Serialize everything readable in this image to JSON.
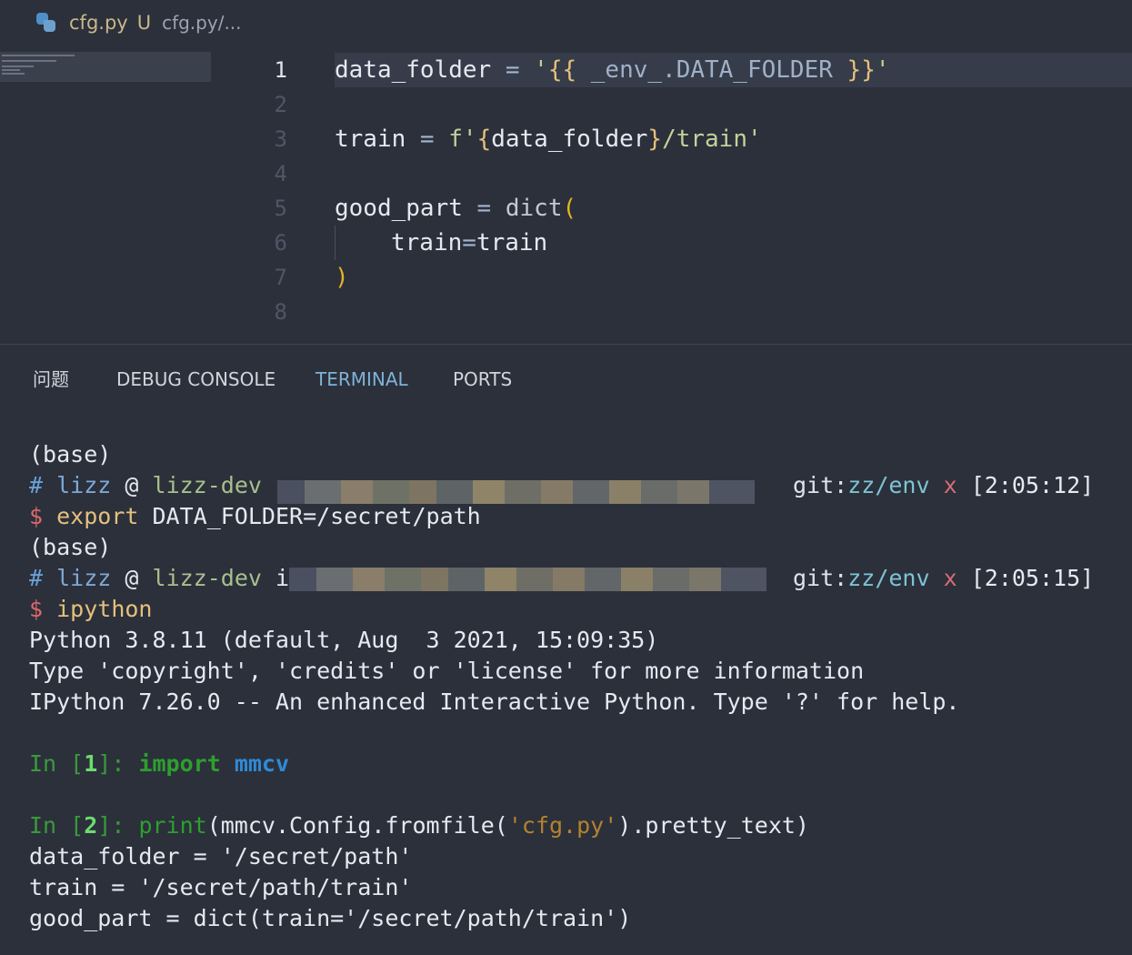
{
  "tab": {
    "filename": "cfg.py",
    "status": "U",
    "path": "cfg.py/..."
  },
  "editor": {
    "line_numbers": [
      "1",
      "2",
      "3",
      "4",
      "5",
      "6",
      "7",
      "8"
    ],
    "l1_var": "data_folder",
    "l1_eq": " = ",
    "l1_q1": "'",
    "l1_open": "{{",
    "l1_mid": " _env_.DATA_FOLDER ",
    "l1_close": "}}",
    "l1_q2": "'",
    "l3_var": "train",
    "l3_eq": " = ",
    "l3_f": "f'",
    "l3_open": "{",
    "l3_inner": "data_folder",
    "l3_close": "}",
    "l3_rest": "/train'",
    "l5_var": "good_part",
    "l5_eq": " = ",
    "l5_fn": "dict",
    "l5_paren": "(",
    "l6_k": "train",
    "l6_eq": "=",
    "l6_v": "train",
    "l7_paren": ")"
  },
  "panel": {
    "tabs": [
      "问题",
      "DEBUG CONSOLE",
      "TERMINAL",
      "PORTS"
    ]
  },
  "terminal": {
    "base": "(base)",
    "hash": "#",
    "user": "lizz",
    "at": "@",
    "host": "lizz-dev",
    "in1": "i",
    "git_label": "git:",
    "branch": "zz/env",
    "x": "x",
    "time1": "[2:05:12]",
    "time2": "[2:05:15]",
    "dollar": "$",
    "cmd1": "export",
    "cmd1_arg": "DATA_FOLDER=/secret/path",
    "cmd2": "ipython",
    "py_ver": "Python 3.8.11 (default, Aug  3 2021, 15:09:35)",
    "type_line": "Type 'copyright', 'credits' or 'license' for more information",
    "ipy_line": "IPython 7.26.0 -- An enhanced Interactive Python. Type '?' for help.",
    "in_label": "In",
    "in1_num": "1",
    "in2_num": "2",
    "import_kw": "import",
    "import_mod": "mmcv",
    "print_fn": "print",
    "print_pre": "(mmcv.Config.fromfile(",
    "print_str": "'cfg.py'",
    "print_post": ").pretty_text)",
    "out1": "data_folder = '/secret/path'",
    "out2": "train = '/secret/path/train'",
    "out3": "good_part = dict(train='/secret/path/train')"
  },
  "colors": {
    "background": "#2b303b",
    "active_tab": "#7fb3d5",
    "prompt_dollar": "#d96a6a",
    "ipython_in": "#3a9a3a"
  }
}
